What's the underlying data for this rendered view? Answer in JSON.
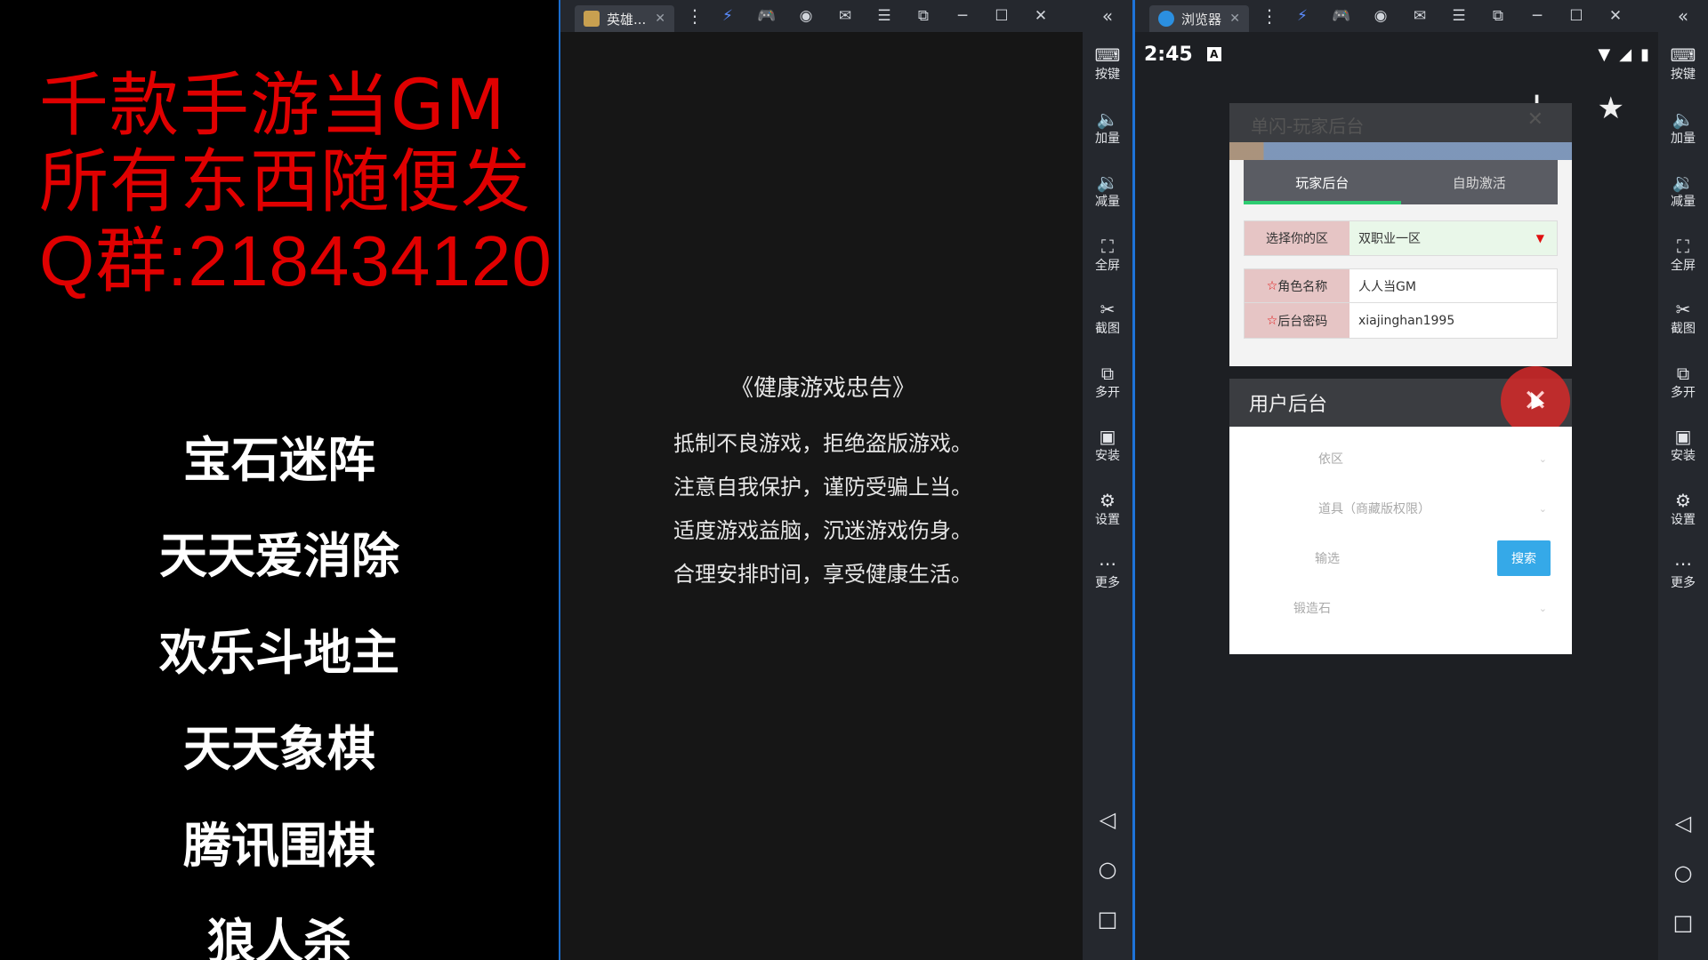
{
  "promo": {
    "lines": [
      "千款手游当GM",
      "所有东西随便发",
      "Q群:218434120"
    ],
    "games": [
      "宝石迷阵",
      "天天爱消除",
      "欢乐斗地主",
      "天天象棋",
      "腾讯围棋",
      "狼人杀"
    ]
  },
  "emulator1": {
    "tab_title": "英雄...",
    "advisory": {
      "title": "《健康游戏忠告》",
      "lines": [
        "抵制不良游戏，拒绝盗版游戏。",
        "注意自我保护，谨防受骗上当。",
        "适度游戏益脑，沉迷游戏伤身。",
        "合理安排时间，享受健康生活。"
      ]
    }
  },
  "emulator2": {
    "tab_title": "浏览器",
    "status": {
      "time": "2:45",
      "a_badge": "A"
    },
    "card1": {
      "ghost_title": "单闪-玩家后台",
      "tabs": [
        "玩家后台",
        "自助激活"
      ],
      "fields": {
        "zone_label": "选择你的区",
        "zone_value": "双职业一区",
        "role_label": "角色名称",
        "role_value": "人人当GM",
        "pass_label": "后台密码",
        "pass_value": "xiajinghan1995"
      }
    },
    "card2": {
      "title": "用户后台",
      "rows": [
        "依区",
        "道具（商藏版权限）",
        "输选",
        "锻造石"
      ],
      "search_label": "搜索"
    }
  },
  "sidebar": {
    "items": [
      "按键",
      "加量",
      "减量",
      "全屏",
      "截图",
      "多开",
      "安装",
      "设置",
      "更多"
    ]
  },
  "icons": {
    "sidebar": [
      "keyboard-icon",
      "volume-up-icon",
      "volume-down-icon",
      "fullscreen-icon",
      "scissors-icon",
      "multi-instance-icon",
      "apk-install-icon",
      "settings-icon",
      "more-icon"
    ],
    "nav": [
      "back-icon",
      "home-icon",
      "recents-icon"
    ]
  },
  "colors": {
    "promo_red": "#e00000",
    "accent_blue": "#1e73d8",
    "tab_green": "#2ecc71",
    "close_red": "#dc2828",
    "search_blue": "#35a9e8"
  }
}
